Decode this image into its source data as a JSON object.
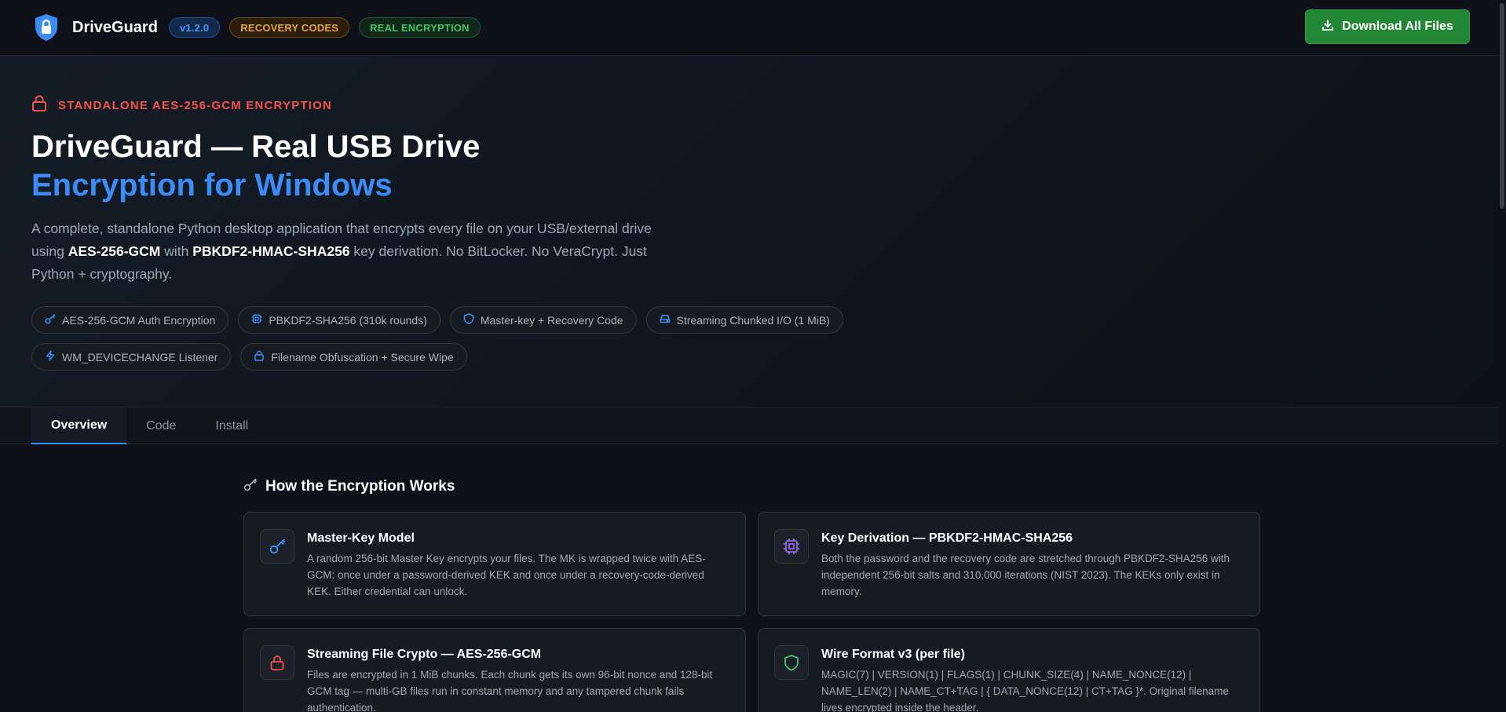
{
  "topbar": {
    "brand": "DriveGuard",
    "version": "v1.2.0",
    "badge_recovery": "RECOVERY CODES",
    "badge_real": "REAL ENCRYPTION",
    "download_label": "Download All Files"
  },
  "hero": {
    "eyebrow": "STANDALONE AES-256-GCM ENCRYPTION",
    "title_line1": "DriveGuard — Real USB Drive",
    "title_line2": "Encryption for Windows",
    "desc_part1": "A complete, standalone Python desktop application that encrypts every file on your USB/external drive using ",
    "desc_bold1": "AES-256-GCM",
    "desc_part2": " with ",
    "desc_bold2": "PBKDF2-HMAC-SHA256",
    "desc_part3": " key derivation. No BitLocker. No VeraCrypt. Just Python + cryptography.",
    "chips": [
      {
        "label": "AES-256-GCM Auth Encryption",
        "icon": "key-icon"
      },
      {
        "label": "PBKDF2-SHA256 (310k rounds)",
        "icon": "cpu-icon"
      },
      {
        "label": "Master-key + Recovery Code",
        "icon": "shield-icon"
      },
      {
        "label": "Streaming Chunked I/O (1 MiB)",
        "icon": "drive-icon"
      },
      {
        "label": "WM_DEVICECHANGE Listener",
        "icon": "lightning-icon"
      },
      {
        "label": "Filename Obfuscation + Secure Wipe",
        "icon": "lock-icon"
      }
    ]
  },
  "tabs": [
    {
      "label": "Overview",
      "active": true
    },
    {
      "label": "Code",
      "active": false
    },
    {
      "label": "Install",
      "active": false
    }
  ],
  "section": {
    "title": "How the Encryption Works",
    "cards": [
      {
        "title": "Master-Key Model",
        "text": "A random 256-bit Master Key encrypts your files. The MK is wrapped twice with AES-GCM: once under a password-derived KEK and once under a recovery-code-derived KEK. Either credential can unlock.",
        "icon": "key-icon"
      },
      {
        "title": "Key Derivation — PBKDF2-HMAC-SHA256",
        "text": "Both the password and the recovery code are stretched through PBKDF2-SHA256 with independent 256-bit salts and 310,000 iterations (NIST 2023). The KEKs only exist in memory.",
        "icon": "cpu-icon"
      },
      {
        "title": "Streaming File Crypto — AES-256-GCM",
        "text": "Files are encrypted in 1 MiB chunks. Each chunk gets its own 96-bit nonce and 128-bit GCM tag — multi-GB files run in constant memory and any tampered chunk fails authentication.",
        "icon": "lock-icon"
      },
      {
        "title": "Wire Format v3 (per file)",
        "text": "MAGIC(7) | VERSION(1) | FLAGS(1) | CHUNK_SIZE(4) | NAME_NONCE(12) | NAME_LEN(2) | NAME_CT+TAG | { DATA_NONCE(12) | CT+TAG }*. Original filename lives encrypted inside the header.",
        "icon": "shield-icon"
      }
    ]
  },
  "colors": {
    "accent_blue": "#3b8cf6",
    "danger_red": "#f85149",
    "success_green": "#238636",
    "warning_orange": "#e6a23c",
    "background": "#0d1117"
  }
}
